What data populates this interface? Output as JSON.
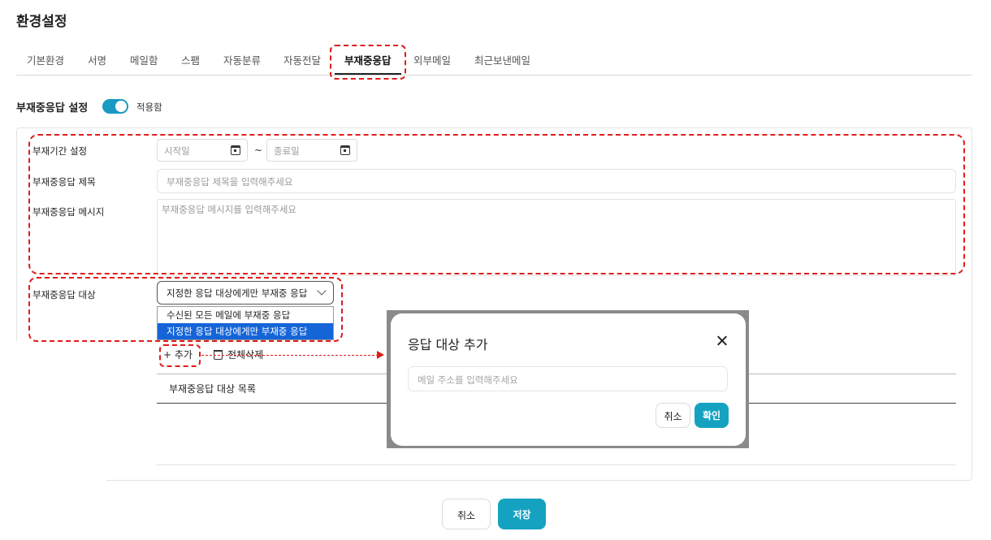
{
  "page_title": "환경설정",
  "tabs": [
    {
      "label": "기본환경"
    },
    {
      "label": "서명"
    },
    {
      "label": "메일함"
    },
    {
      "label": "스팸"
    },
    {
      "label": "자동분류"
    },
    {
      "label": "자동전달"
    },
    {
      "label": "부재중응답",
      "active": true
    },
    {
      "label": "외부메일"
    },
    {
      "label": "최근보낸메일"
    }
  ],
  "section": {
    "title": "부재중응답 설정",
    "toggle_on": true,
    "toggle_label": "적용함"
  },
  "form": {
    "period": {
      "label": "부재기간 설정",
      "start_placeholder": "시작일",
      "separator": "~",
      "end_placeholder": "종료일"
    },
    "subject": {
      "label": "부재중응답 제목",
      "placeholder": "부재중응답 제목을 입력해주세요"
    },
    "message": {
      "label": "부재중응답 메시지",
      "placeholder": "부재중응답 메시지를 입력해주세요"
    },
    "target": {
      "label": "부재중응답 대상",
      "selected": "지정한 응답 대상에게만 부재중 응답",
      "options": [
        "수신된 모든 메일에 부재중 응답",
        "지정한 응답 대상에게만 부재중 응답"
      ],
      "selected_index": 1
    },
    "add_label": "추가",
    "add_icon": "+",
    "delete_all_label": "전체삭제",
    "list_header": "부재중응답 대상 목록"
  },
  "footer": {
    "cancel_label": "취소",
    "save_label": "저장"
  },
  "modal": {
    "title": "응답 대상 추가",
    "input_placeholder": "메일 주소를 입력해주세요",
    "cancel_label": "취소",
    "confirm_label": "확인"
  },
  "colors": {
    "accent": "#15a2c1",
    "toggle": "#1a9ac2",
    "annotation_red": "#e01b1b",
    "selected_option": "#1565d8"
  }
}
